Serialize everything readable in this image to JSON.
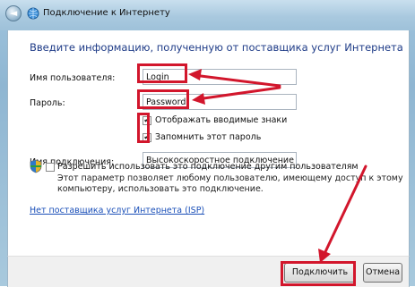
{
  "window": {
    "title": "Подключение к Интернету"
  },
  "form": {
    "heading": "Введите информацию, полученную от поставщика услуг Интернета",
    "username_label": "Имя пользователя:",
    "username_value": "Login",
    "password_label": "Пароль:",
    "password_value": "Password",
    "show_chars_label": "Отображать вводимые знаки",
    "show_chars_checked": true,
    "remember_label": "Запомнить этот пароль",
    "remember_checked": true,
    "connection_name_label": "Имя подключения:",
    "connection_name_value": "Высокоскоростное подключение",
    "allow_others_label": "Разрешить использовать это подключение другим пользователям",
    "allow_others_checked": false,
    "allow_others_desc": "Этот параметр позволяет любому пользователю, имеющему доступ к этому компьютеру, использовать это подключение.",
    "no_isp_link": "Нет поставщика услуг Интернета (ISP)"
  },
  "buttons": {
    "connect": "Подключить",
    "cancel": "Отмена"
  },
  "icons": {
    "back": "back-arrow-icon",
    "network": "network-icon",
    "shield": "shield-icon"
  },
  "colors": {
    "annotation_red": "#d2162c",
    "heading_blue": "#1e3b87",
    "link_blue": "#1a4fb8"
  }
}
